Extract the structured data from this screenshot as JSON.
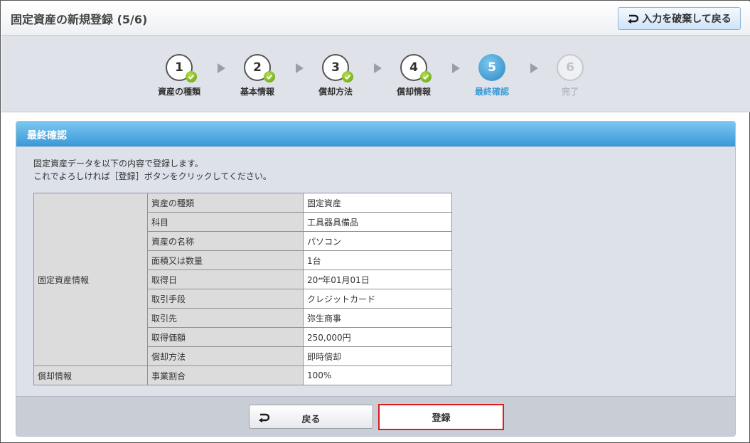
{
  "header": {
    "title": "固定資産の新規登録 (5/6)",
    "discard_label": "入力を破棄して戻る"
  },
  "steps": [
    {
      "number": "1",
      "label": "資産の種類",
      "state": "done"
    },
    {
      "number": "2",
      "label": "基本情報",
      "state": "done"
    },
    {
      "number": "3",
      "label": "償却方法",
      "state": "done"
    },
    {
      "number": "4",
      "label": "償却情報",
      "state": "done"
    },
    {
      "number": "5",
      "label": "最終確認",
      "state": "active"
    },
    {
      "number": "6",
      "label": "完了",
      "state": "future"
    }
  ],
  "panel": {
    "title": "最終確認",
    "description_line1": "固定資産データを以下の内容で登録します。",
    "description_line2": "これでよろしければ［登録］ボタンをクリックしてください。"
  },
  "table": {
    "group1": "固定資産情報",
    "group2": "償却情報",
    "rows": [
      {
        "field": "資産の種類",
        "value": "固定資産"
      },
      {
        "field": "科目",
        "value": "工具器具備品"
      },
      {
        "field": "資産の名称",
        "value": "パソコン"
      },
      {
        "field": "面積又は数量",
        "value": "1台"
      },
      {
        "field": "取得日",
        "value_prefix": "20",
        "value_mask": "**",
        "value_suffix": "年01月01日"
      },
      {
        "field": "取引手段",
        "value": "クレジットカード"
      },
      {
        "field": "取引先",
        "value": "弥生商事"
      },
      {
        "field": "取得価額",
        "value": "250,000円"
      },
      {
        "field": "償却方法",
        "value": "即時償却"
      },
      {
        "field": "事業割合",
        "value": "100%"
      }
    ]
  },
  "footer": {
    "back_label": "戻る",
    "register_label": "登録"
  },
  "colors": {
    "accent": "#3b9ad8",
    "check": "#5a9a12",
    "highlight": "#e01a22"
  }
}
